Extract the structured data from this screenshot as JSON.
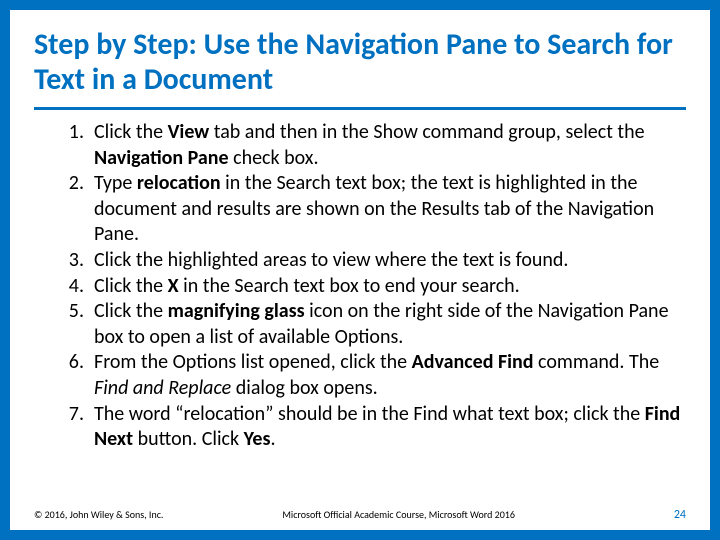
{
  "title": "Step by Step: Use the Navigation Pane to Search for Text in a Document",
  "steps": {
    "s1a": "Click the ",
    "s1b": "View",
    "s1c": " tab and then in the Show command group, select the ",
    "s1d": "Navigation Pane",
    "s1e": " check box.",
    "s2a": "Type ",
    "s2b": "relocation",
    "s2c": " in the Search text box; the text is highlighted in the document and results are shown on the Results tab of the Navigation Pane.",
    "s3": "Click the highlighted areas to view where the text is found.",
    "s4a": "Click the ",
    "s4b": "X",
    "s4c": " in the Search text box to end your search.",
    "s5a": "Click the ",
    "s5b": "magnifying glass",
    "s5c": " icon on the right side of the Navigation Pane box to open a list of available Options.",
    "s6a": "From the Options list opened, click the ",
    "s6b": "Advanced Find",
    "s6c": " command. The ",
    "s6d": "Find and Replace",
    "s6e": " dialog box opens.",
    "s7a": "The word “relocation” should be in the Find what text box; click the ",
    "s7b": "Find Next",
    "s7c": " button. Click ",
    "s7d": "Yes",
    "s7e": "."
  },
  "footer": {
    "copyright": "© 2016, John Wiley & Sons, Inc.",
    "course": "Microsoft Official Academic Course, Microsoft Word 2016",
    "page": "24"
  }
}
